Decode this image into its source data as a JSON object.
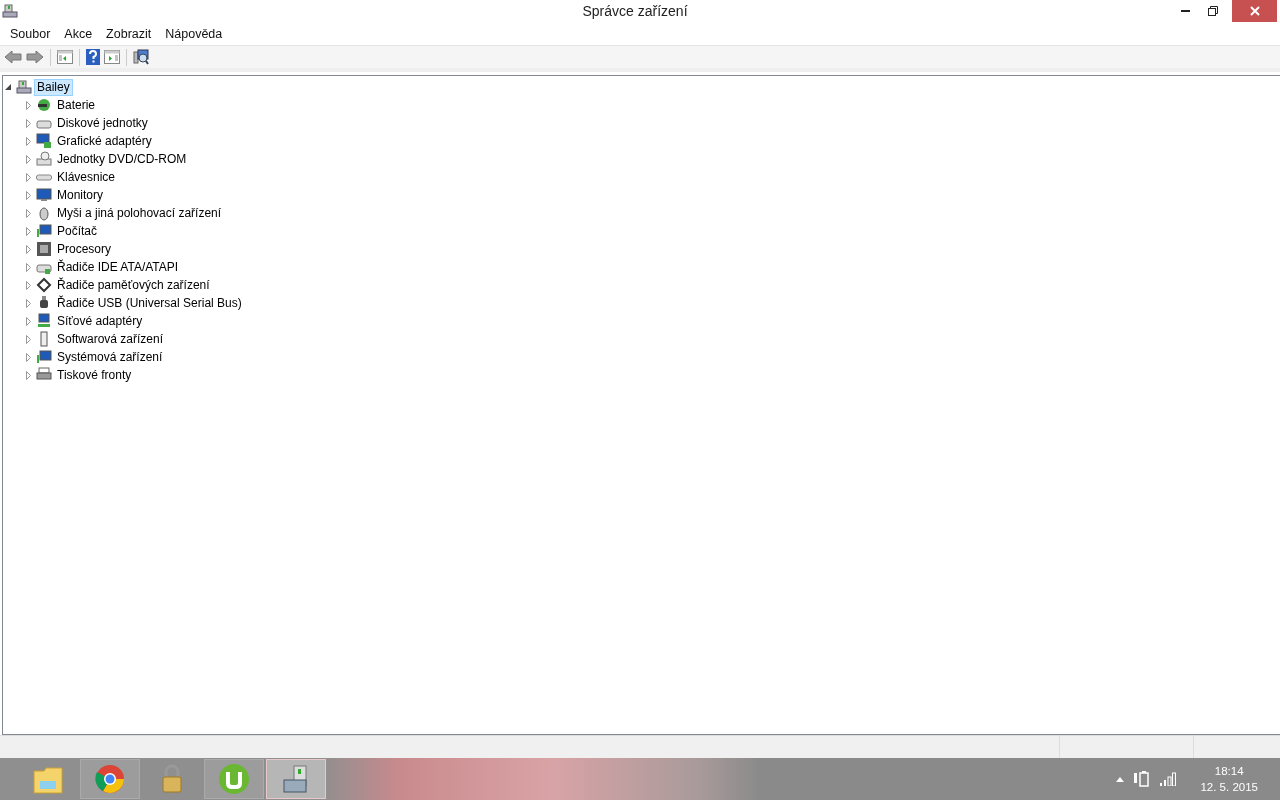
{
  "window": {
    "title": "Správce zařízení"
  },
  "menu": [
    "Soubor",
    "Akce",
    "Zobrazit",
    "Nápověda"
  ],
  "tree": {
    "label": "Bailey",
    "expanded": true,
    "selected": true,
    "children": [
      {
        "label": "Baterie",
        "expanded": false
      },
      {
        "label": "Diskové jednotky",
        "expanded": false
      },
      {
        "label": "Grafické adaptéry",
        "expanded": false
      },
      {
        "label": "Jednotky DVD/CD-ROM",
        "expanded": false
      },
      {
        "label": "Klávesnice",
        "expanded": false
      },
      {
        "label": "Monitory",
        "expanded": false
      },
      {
        "label": "Myši a jiná polohovací zařízení",
        "expanded": false
      },
      {
        "label": "Počítač",
        "expanded": false
      },
      {
        "label": "Procesory",
        "expanded": false
      },
      {
        "label": "Řadiče IDE ATA/ATAPI",
        "expanded": false
      },
      {
        "label": "Řadiče paměťových zařízení",
        "expanded": false
      },
      {
        "label": "Řadiče USB (Universal Serial Bus)",
        "expanded": false
      },
      {
        "label": "Síťové adaptéry",
        "expanded": false
      },
      {
        "label": "Softwarová zařízení",
        "expanded": false
      },
      {
        "label": "Systémová zařízení",
        "expanded": false
      },
      {
        "label": "Tiskové fronty",
        "expanded": false
      }
    ]
  },
  "taskbar": {
    "apps": [
      {
        "running": false,
        "selected": false
      },
      {
        "running": true,
        "selected": false
      },
      {
        "running": false,
        "selected": false
      },
      {
        "running": true,
        "selected": false
      },
      {
        "running": true,
        "selected": true
      }
    ],
    "clock": {
      "time": "18:14",
      "date": "12. 5. 2015"
    }
  }
}
